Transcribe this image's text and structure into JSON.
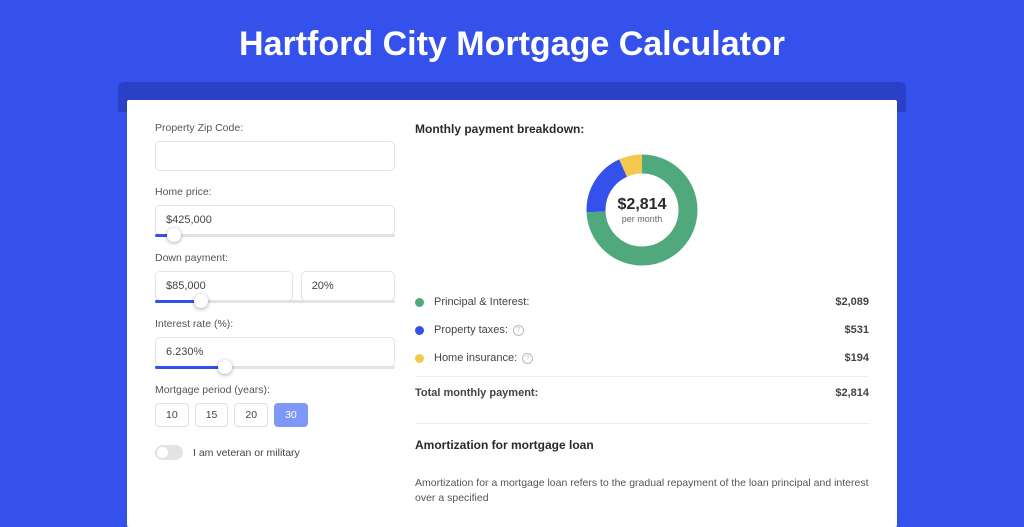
{
  "title": "Hartford City Mortgage Calculator",
  "form": {
    "zip_label": "Property Zip Code:",
    "zip_value": "",
    "home_price_label": "Home price:",
    "home_price_value": "$425,000",
    "home_price_slider_pct": 8,
    "down_payment_label": "Down payment:",
    "down_payment_value": "$85,000",
    "down_payment_pct_value": "20%",
    "down_payment_slider_pct": 19,
    "interest_label": "Interest rate (%):",
    "interest_value": "6.230%",
    "interest_slider_pct": 29,
    "period_label": "Mortgage period (years):",
    "periods": [
      "10",
      "15",
      "20",
      "30"
    ],
    "period_active": 3,
    "veteran_label": "I am veteran or military"
  },
  "breakdown": {
    "title": "Monthly payment breakdown:",
    "center_amount": "$2,814",
    "center_sub": "per month",
    "legend": {
      "principal_label": "Principal & Interest:",
      "principal_value": "$2,089",
      "taxes_label": "Property taxes:",
      "taxes_value": "$531",
      "insurance_label": "Home insurance:",
      "insurance_value": "$194",
      "total_label": "Total monthly payment:",
      "total_value": "$2,814"
    }
  },
  "amortization": {
    "title": "Amortization for mortgage loan",
    "text": "Amortization for a mortgage loan refers to the gradual repayment of the loan principal and interest over a specified"
  },
  "chart_data": {
    "type": "pie",
    "title": "Monthly payment breakdown",
    "series": [
      {
        "name": "Principal & Interest",
        "value": 2089,
        "color": "#4fa97d"
      },
      {
        "name": "Property taxes",
        "value": 531,
        "color": "#3452eb"
      },
      {
        "name": "Home insurance",
        "value": 194,
        "color": "#f2c94c"
      }
    ],
    "total": 2814,
    "center_label": "$2,814 per month"
  }
}
